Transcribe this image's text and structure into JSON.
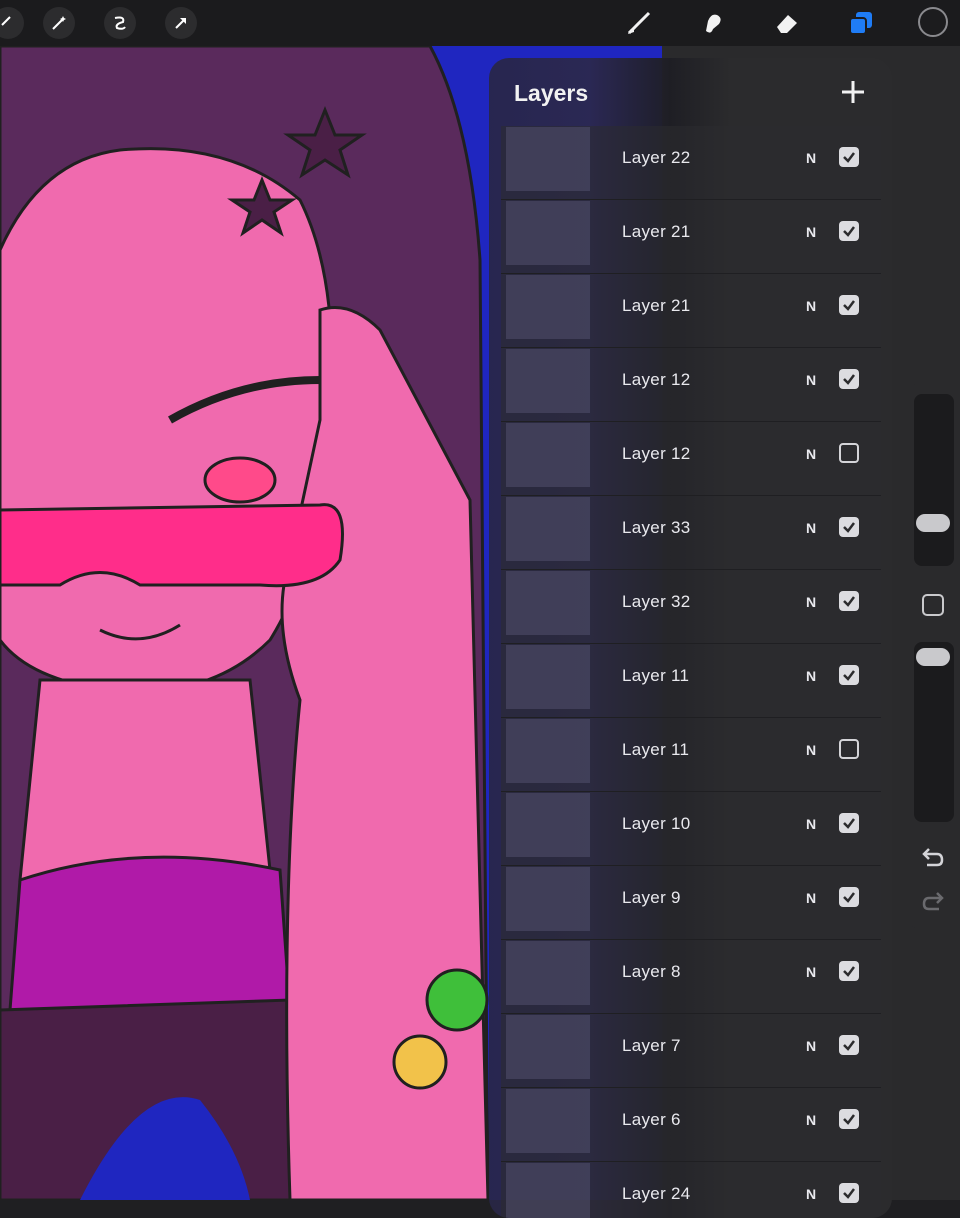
{
  "app": {
    "top_bar": {
      "left_tools": [
        "wrench-icon",
        "magic-wand-icon",
        "selection-icon",
        "transform-arrow-icon"
      ],
      "right_tools": [
        "brush-icon",
        "smudge-icon",
        "eraser-icon",
        "layers-icon",
        "color-well"
      ],
      "accent_color": "#1f7cf5"
    },
    "layers_panel": {
      "title": "Layers",
      "add_icon": "plus-icon",
      "layers": [
        {
          "name": "Layer 22",
          "blend": "N",
          "visible": true
        },
        {
          "name": "Layer 21",
          "blend": "N",
          "visible": true
        },
        {
          "name": "Layer 21",
          "blend": "N",
          "visible": true
        },
        {
          "name": "Layer 12",
          "blend": "N",
          "visible": true
        },
        {
          "name": "Layer 12",
          "blend": "N",
          "visible": false
        },
        {
          "name": "Layer 33",
          "blend": "N",
          "visible": true
        },
        {
          "name": "Layer 32",
          "blend": "N",
          "visible": true
        },
        {
          "name": "Layer 11",
          "blend": "N",
          "visible": true
        },
        {
          "name": "Layer 11",
          "blend": "N",
          "visible": false
        },
        {
          "name": "Layer 10",
          "blend": "N",
          "visible": true
        },
        {
          "name": "Layer 9",
          "blend": "N",
          "visible": true
        },
        {
          "name": "Layer 8",
          "blend": "N",
          "visible": true
        },
        {
          "name": "Layer 7",
          "blend": "N",
          "visible": true
        },
        {
          "name": "Layer 6",
          "blend": "N",
          "visible": true
        },
        {
          "name": "Layer 24",
          "blend": "N",
          "visible": true
        }
      ]
    },
    "side_bar": {
      "icons": [
        "brush-size-slider",
        "modify-button",
        "opacity-slider",
        "undo-icon",
        "redo-icon"
      ]
    }
  }
}
